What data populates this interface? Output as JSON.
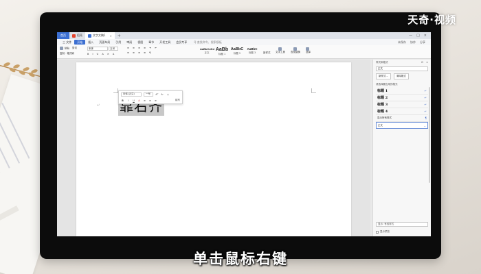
{
  "watermark": "天奇·视频",
  "caption": "单击鼠标右键",
  "tabbar": {
    "home": "首页",
    "tabs": [
      {
        "label": "稻壳",
        "icon": "daoke-icon"
      },
      {
        "label": "文字文稿1",
        "icon": "wps-doc-icon"
      }
    ],
    "close": "×",
    "add": "+",
    "controls": [
      "—",
      "□",
      "×"
    ]
  },
  "menu": {
    "file": "三 文件",
    "items": [
      "开始",
      "插入",
      "页面布局",
      "引用",
      "审阅",
      "视图",
      "章节",
      "开发工具",
      "会员专享"
    ],
    "active": "开始",
    "search": "Q 查找命令、搜索模板",
    "right": [
      "未保存",
      "协作",
      "分享"
    ]
  },
  "ribbon": {
    "paste": "粘贴",
    "cut": "剪切",
    "copy": "复制",
    "format_painter": "格式刷",
    "font": "宋体",
    "size": "五号",
    "styles": [
      {
        "sample": "AaBbCcDd",
        "label": "正文"
      },
      {
        "sample": "AaBb",
        "label": "标题 1"
      },
      {
        "sample": "AaBbC",
        "label": "标题 2"
      },
      {
        "sample": "AaBbC",
        "label": "标题 3"
      }
    ],
    "new_style": "新样式",
    "text_tools": "文字工具",
    "find_replace": "查找替换",
    "select": "选择"
  },
  "document": {
    "selected_text": "靠右齐",
    "para_mark": "↵"
  },
  "mini_toolbar": {
    "font": "宋体(正文)",
    "size": "一号",
    "buttons_row1": [
      "A⁺",
      "A⁻",
      "◇"
    ],
    "buttons_row2": [
      "B",
      "I",
      "U",
      "A",
      "≡",
      "≡",
      "≡"
    ],
    "last": "续写"
  },
  "style_panel": {
    "title": "样式和格式",
    "current_label": "正文",
    "new_button": "新样式...",
    "clear_button": "清除格式",
    "section_label": "请选择要应用的格式",
    "styles": [
      "标题 1",
      "标题 2",
      "标题 3",
      "标题 4"
    ],
    "show_all": "显示所有样式",
    "selected": "正文",
    "footer": "显示: 有效样式",
    "checkbox": "显示预览"
  }
}
